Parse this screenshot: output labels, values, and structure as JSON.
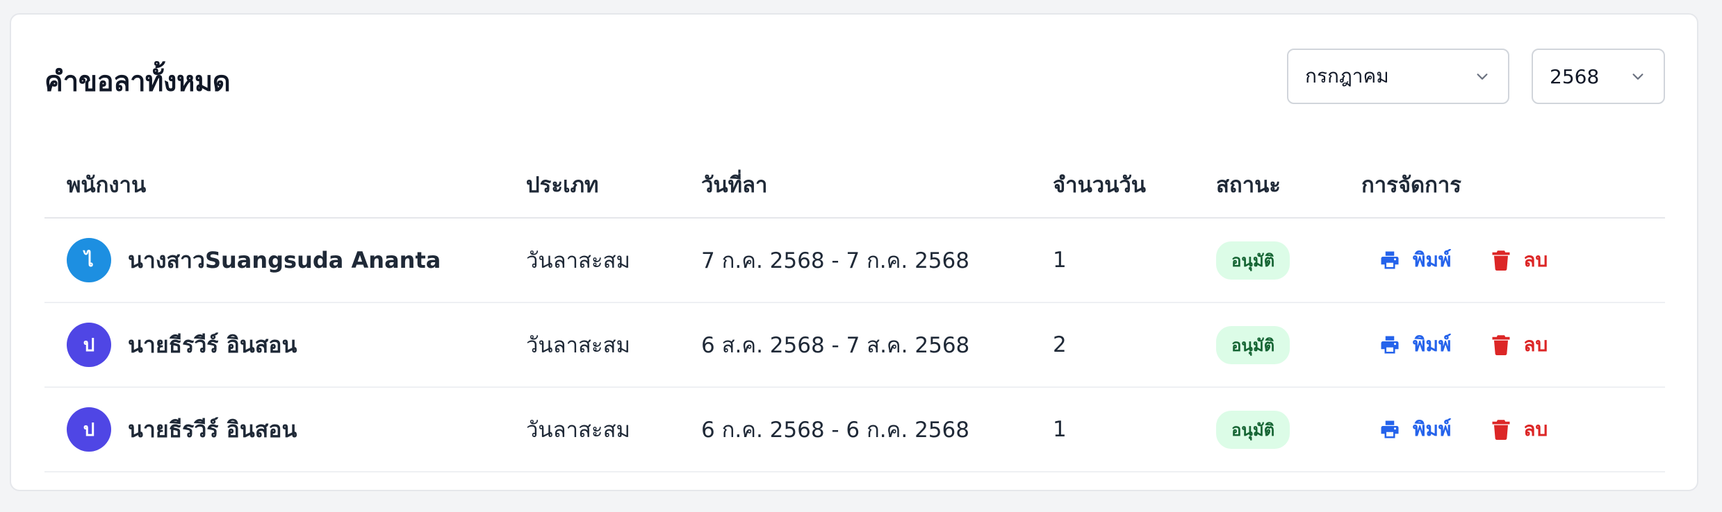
{
  "page": {
    "title": "คำขอลาทั้งหมด"
  },
  "filters": {
    "month": {
      "value": "กรกฎาคม",
      "icon": "chevron-down-icon"
    },
    "year": {
      "value": "2568",
      "icon": "chevron-down-icon"
    }
  },
  "table": {
    "headers": {
      "employee": "พนักงาน",
      "type": "ประเภท",
      "dates": "วันที่ลา",
      "days": "จำนวนวัน",
      "status": "สถานะ",
      "actions": "การจัดการ"
    },
    "rows": [
      {
        "initial": "ไ",
        "avatar_color": "#1d8fe1",
        "name": "นางสาวSuangsuda Ananta",
        "type": "วันลาสะสม",
        "dates": "7 ก.ค. 2568 - 7 ก.ค. 2568",
        "days": "1",
        "status": "อนุมัติ",
        "print_label": "พิมพ์",
        "delete_label": "ลบ"
      },
      {
        "initial": "ป",
        "avatar_color": "#4f46e5",
        "name": "นายธีรวีร์ อินสอน",
        "type": "วันลาสะสม",
        "dates": "6 ส.ค. 2568 - 7 ส.ค. 2568",
        "days": "2",
        "status": "อนุมัติ",
        "print_label": "พิมพ์",
        "delete_label": "ลบ"
      },
      {
        "initial": "ป",
        "avatar_color": "#4f46e5",
        "name": "นายธีรวีร์ อินสอน",
        "type": "วันลาสะสม",
        "dates": "6 ก.ค. 2568 - 6 ก.ค. 2568",
        "days": "1",
        "status": "อนุมัติ",
        "print_label": "พิมพ์",
        "delete_label": "ลบ"
      }
    ]
  },
  "colors": {
    "accent": "#2563eb",
    "danger": "#dc2626",
    "status_approved_bg": "#dcfce7",
    "status_approved_text": "#166534"
  },
  "icons": {
    "print": "printer-icon",
    "delete": "trash-icon"
  }
}
